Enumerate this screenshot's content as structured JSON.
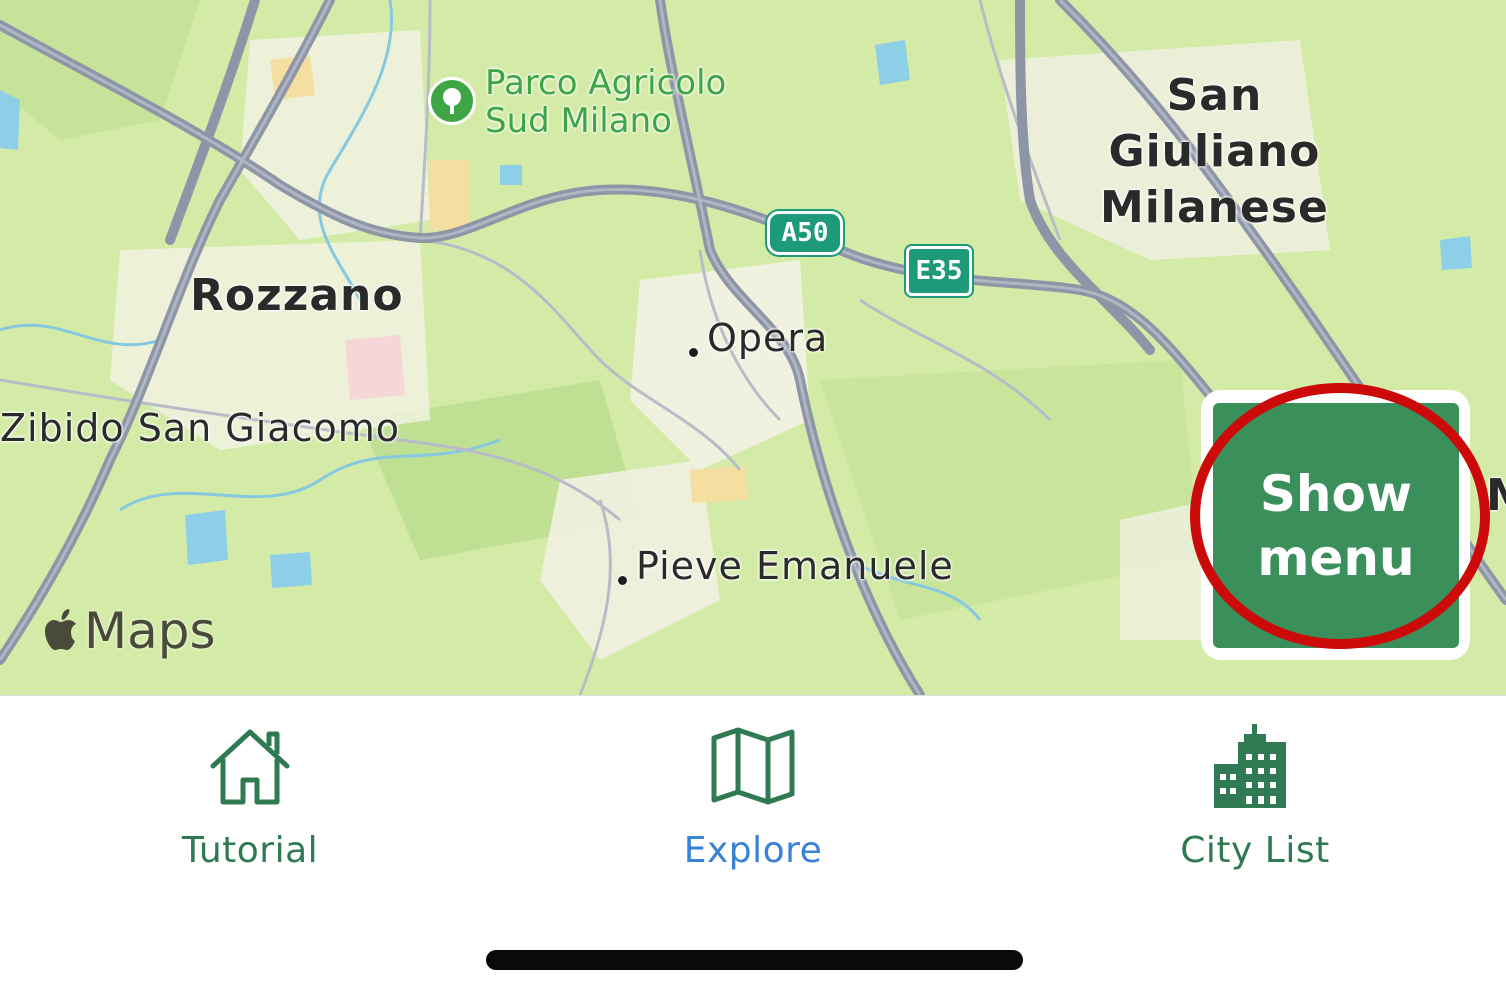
{
  "map": {
    "places": {
      "park": "Parco Agricolo\nSud Milano",
      "san_giuliano": "San\nGiuliano\nMilanese",
      "rozzano": "Rozzano",
      "opera": "Opera",
      "zibido": "Zibido San Giacomo",
      "pieve": "Pieve Emanuele",
      "partial_right": "M"
    },
    "road_shields": {
      "a50": "A50",
      "e35": "E35"
    },
    "attribution": "Maps"
  },
  "show_menu_button": {
    "line1": "Show",
    "line2": "menu"
  },
  "tabbar": {
    "tabs": [
      {
        "label": "Tutorial",
        "icon": "house-icon",
        "active": false
      },
      {
        "label": "Explore",
        "icon": "map-icon",
        "active": true
      },
      {
        "label": "City List",
        "icon": "city-buildings-icon",
        "active": false
      }
    ]
  },
  "colors": {
    "map_green": "#d3eba6",
    "brand_green": "#3a8f5b",
    "active_tab_blue": "#3a82d6",
    "highlight_red": "#cc0a0a",
    "road_shield": "#1d9a79"
  }
}
